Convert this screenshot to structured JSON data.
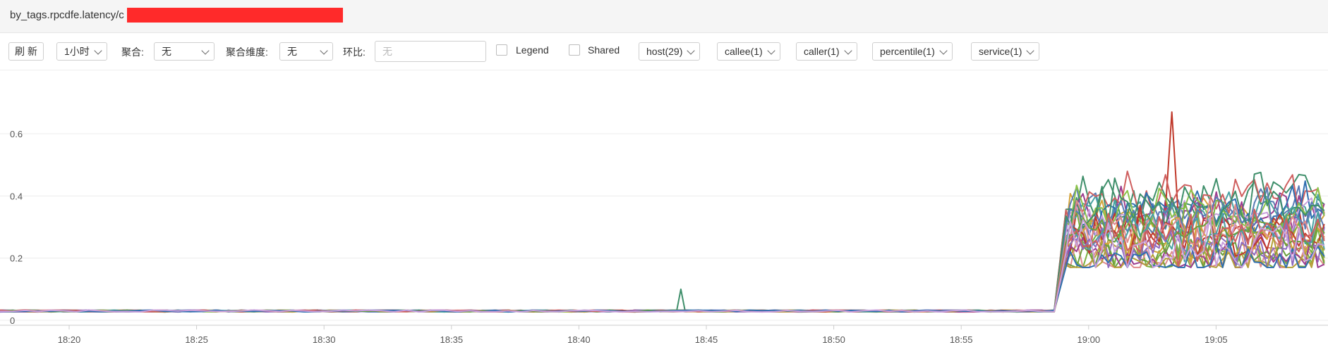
{
  "header": {
    "title": "by_tags.rpcdfe.latency/c"
  },
  "toolbar": {
    "refresh_label": "刷 新",
    "time_range": "1小时",
    "aggregate_label": "聚合:",
    "aggregate_value": "无",
    "agg_dim_label": "聚合维度:",
    "agg_dim_value": "无",
    "ratio_label": "环比:",
    "ratio_placeholder": "无",
    "legend_label": "Legend",
    "shared_label": "Shared",
    "filters": [
      "host(29)",
      "callee(1)",
      "caller(1)",
      "percentile(1)",
      "service(1)"
    ]
  },
  "chart_data": {
    "type": "line",
    "title": "",
    "xlabel": "",
    "ylabel": "",
    "x_ticks": [
      "18:20",
      "18:25",
      "18:30",
      "18:35",
      "18:40",
      "18:45",
      "18:50",
      "18:55",
      "19:00",
      "19:05"
    ],
    "y_ticks": [
      "0",
      "0.2",
      "0.4",
      "0.6"
    ],
    "ylim": [
      0,
      0.8
    ],
    "xlim_minutes": [
      18.3,
      19.16
    ],
    "grid": true,
    "legend": "none",
    "series_count": 29,
    "baseline_value": 0.03,
    "spike": {
      "time": "18:44",
      "value": 0.1
    },
    "step_time": "18:59",
    "after_step_range": [
      0.18,
      0.5
    ],
    "peak": {
      "time": "19:03",
      "value": 0.67
    },
    "colors": [
      "#7cb342",
      "#d4a43a",
      "#5a7bb5",
      "#3f8f6b",
      "#9c3d8f",
      "#c0392b",
      "#e08c8c",
      "#8e6bbf",
      "#4aa3a3",
      "#b5a03a",
      "#6a9f3d",
      "#cf5f5f",
      "#2f6fb0",
      "#c9a0dc",
      "#8bc34a"
    ]
  }
}
